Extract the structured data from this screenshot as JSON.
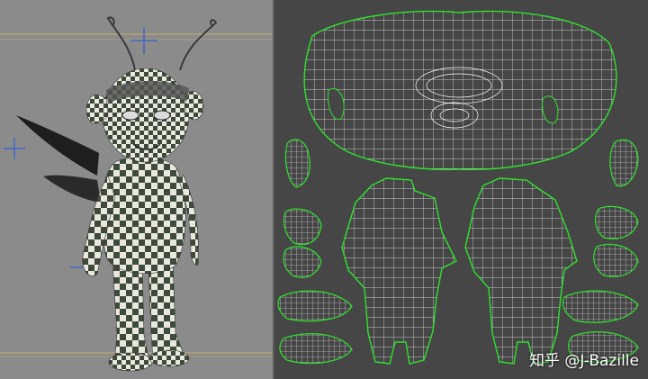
{
  "watermark": {
    "text": "知乎 @J-Bazille"
  },
  "colors": {
    "viewport_bg": "#8b8b8b",
    "uv_bg": "#464646",
    "uv_border": "#2ee12e",
    "uv_wire": "#ffffff",
    "guide_line": "#e0c060",
    "axis_gizmo": "#3060d0",
    "checker_dark": "#3f4a3a",
    "checker_light": "#e8e8e0"
  },
  "panels": {
    "left": {
      "name": "3d-viewport",
      "content": "checker-textured-character-model"
    },
    "right": {
      "name": "uv-editor",
      "content": "uv-layout-wireframe"
    }
  }
}
